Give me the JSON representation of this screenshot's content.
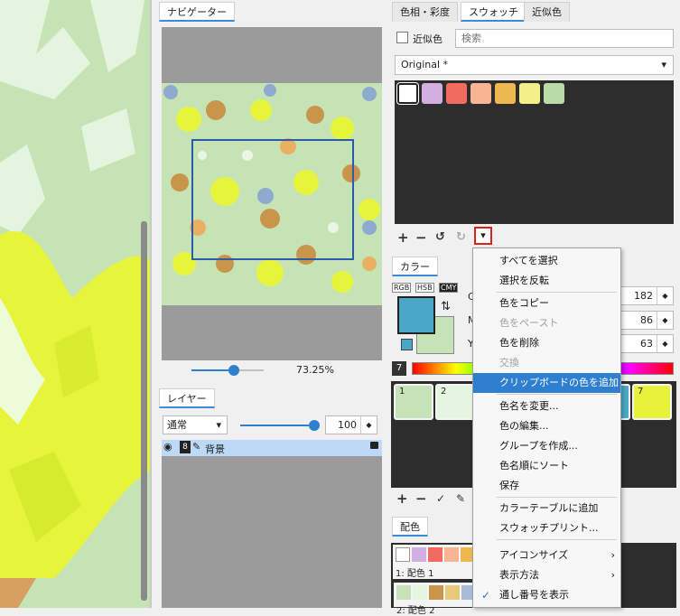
{
  "navigator": {
    "tab": "ナビゲーター",
    "zoom": "73.25%",
    "zoom_fraction": 0.59
  },
  "layers": {
    "tab": "レイヤー",
    "blend_mode": "通常",
    "opacity": "100",
    "opacity_fraction": 1.0,
    "layer_name": "背景",
    "badge": "8"
  },
  "color_tabs": {
    "hue": "色相・彩度",
    "swatch": "スウォッチ",
    "similar": "近似色"
  },
  "swatch_panel": {
    "similar_checkbox_label": "近似色",
    "search_placeholder": "検索",
    "set_name": "Original *",
    "colors": [
      "#ffffff",
      "#d3aee0",
      "#f26b5e",
      "#f8b493",
      "#edb84f",
      "#f3f08a",
      "#b8dba9"
    ]
  },
  "color_panel": {
    "tab": "カラー",
    "modes": [
      "RGB",
      "HSB",
      "CMY"
    ],
    "fields": [
      {
        "label": "C",
        "value": "182"
      },
      {
        "label": "M",
        "value": "86"
      },
      {
        "label": "Y",
        "value": "63"
      }
    ],
    "main_color": "#4aa8c6",
    "sub_color": "#c5e3b6",
    "table_number": "7",
    "cells": [
      {
        "label": "1",
        "color": "#c5e3b6"
      },
      {
        "label": "2",
        "color": "#e6f5df"
      },
      {
        "label": "7",
        "color": "#e8f23a"
      }
    ]
  },
  "palette": {
    "tab": "配色",
    "row1_label": "1: 配色 1",
    "row1_colors": [
      "#ffffff",
      "#d3aee0",
      "#f26b5e",
      "#f8b493",
      "#edb84f"
    ],
    "row2_label": "2: 配色 2",
    "row2_colors": [
      "#c5e3b6",
      "#e6f5df",
      "#c8954a",
      "#e8c87a",
      "#a8bcd8"
    ]
  },
  "context_menu": {
    "items": [
      {
        "label": "すべてを選択",
        "state": "normal"
      },
      {
        "label": "選択を反転",
        "state": "normal"
      },
      {
        "label": "色をコピー",
        "state": "normal"
      },
      {
        "label": "色をペースト",
        "state": "disabled"
      },
      {
        "label": "色を削除",
        "state": "normal"
      },
      {
        "label": "交換",
        "state": "disabled"
      },
      {
        "label": "クリップボードの色を追加",
        "state": "highlighted"
      },
      {
        "label": "色名を変更...",
        "state": "normal"
      },
      {
        "label": "色の編集...",
        "state": "normal"
      },
      {
        "label": "グループを作成...",
        "state": "normal"
      },
      {
        "label": "色名順にソート",
        "state": "normal"
      },
      {
        "label": "保存",
        "state": "normal"
      },
      {
        "label": "カラーテーブルに追加",
        "state": "normal"
      },
      {
        "label": "スウォッチプリント...",
        "state": "normal"
      },
      {
        "label": "アイコンサイズ",
        "state": "submenu"
      },
      {
        "label": "表示方法",
        "state": "submenu"
      },
      {
        "label": "通し番号を表示",
        "state": "checked"
      }
    ],
    "check_glyph": "✓",
    "submenu_glyph": "›"
  },
  "icons": {
    "plus": "+",
    "minus": "−",
    "undo": "↺",
    "redo": "↻",
    "dropdown": "▾",
    "check": "✓",
    "pencil": "✎",
    "lock": "🔒",
    "eye": "👁",
    "swap": "⇅"
  }
}
